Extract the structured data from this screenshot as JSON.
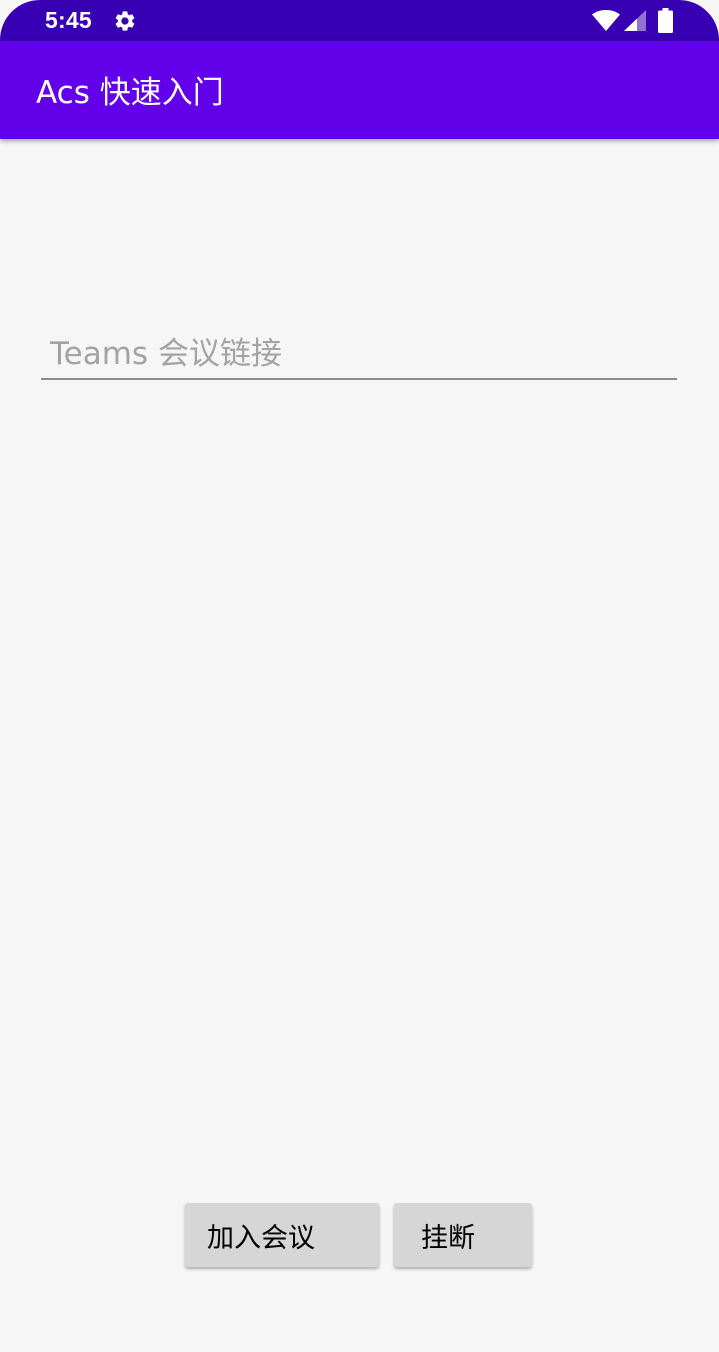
{
  "status_bar": {
    "time": "5:45",
    "bg_color": "#3700b3",
    "icons": [
      "gear-icon",
      "wifi-icon",
      "cell-signal-icon",
      "battery-icon"
    ]
  },
  "app_bar": {
    "title": "Acs 快速入门",
    "bg_color": "#6200ea"
  },
  "meeting_link_input": {
    "placeholder": "Teams 会议链接",
    "value": ""
  },
  "buttons": {
    "join_label": "加入会议",
    "hangup_label": "挂断"
  },
  "colors": {
    "background": "#f6f6f6",
    "button_bg": "#d6d6d6",
    "placeholder": "#a3a3a3",
    "underline": "#8a8a8a"
  }
}
